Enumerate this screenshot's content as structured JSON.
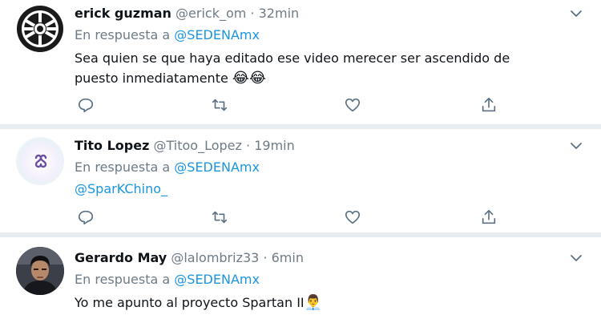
{
  "tweets": [
    {
      "name": "erick guzman",
      "handle": "@erick_om",
      "separator": "·",
      "time": "32min",
      "reply_prefix": "En respuesta a",
      "reply_to": "@SEDENAmx",
      "text": "Sea quien se que haya editado ese video merecer ser ascendido de puesto inmediatamente",
      "emoji": "😂😂",
      "avatar_icon": "galactic-empire-icon"
    },
    {
      "name": "Tito Lopez",
      "handle": "@Titoo_Lopez",
      "separator": "·",
      "time": "19min",
      "reply_prefix": "En respuesta a",
      "reply_to": "@SEDENAmx",
      "mention": "@SparKChino_",
      "avatar_icon": "logo-icon"
    },
    {
      "name": "Gerardo May",
      "handle": "@lalombriz33",
      "separator": "·",
      "time": "6min",
      "reply_prefix": "En respuesta a",
      "reply_to": "@SEDENAmx",
      "text": "Yo me apunto al proyecto Spartan II",
      "emoji": "👨‍💼",
      "avatar_icon": "user-photo"
    }
  ],
  "colors": {
    "link": "#1b95e0",
    "secondary_text": "#6e7b86",
    "divider": "#e6ecf0",
    "icon": "#5b7083"
  }
}
